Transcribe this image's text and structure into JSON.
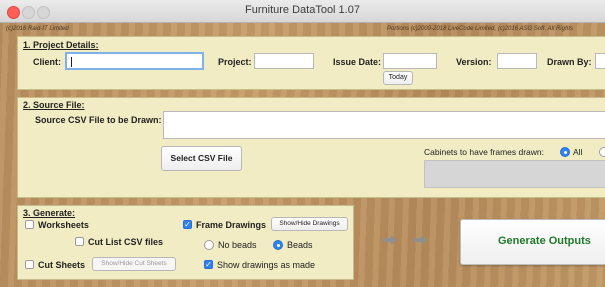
{
  "window": {
    "title": "Furniture DataTool 1.07"
  },
  "header": {
    "left_credit": "(c)2016 Raid-IT Limited",
    "right_credit": "Portions (c)2000-2018 LiveCode Limited, (c)2016 ASG Soft. All Rights"
  },
  "project": {
    "heading": "1. Project Details:",
    "client_label": "Client:",
    "client_value": "",
    "project_label": "Project:",
    "project_value": "",
    "issue_date_label": "Issue Date:",
    "issue_date_value": "",
    "today_button": "Today",
    "version_label": "Version:",
    "version_value": "",
    "drawn_by_label": "Drawn By:",
    "drawn_by_value": ""
  },
  "source": {
    "heading": "2. Source File:",
    "csv_label": "Source CSV File to be Drawn:",
    "csv_value": "",
    "select_button": "Select CSV File",
    "cabinets_label": "Cabinets to have frames drawn:",
    "cabinets_option_all": "All"
  },
  "generate": {
    "heading": "3. Generate:",
    "worksheets_label": "Worksheets",
    "cut_list_label": "Cut List CSV files",
    "cut_sheets_label": "Cut Sheets",
    "show_hide_cut_sheets": "Show/Hide Cut Sheets",
    "frame_drawings_label": "Frame Drawings",
    "show_hide_drawings": "Show/Hide Drawings",
    "no_beads_label": "No beads",
    "beads_label": "Beads",
    "show_drawings_label": "Show drawings as made",
    "generate_button": "Generate Outputs",
    "accent_color": "#2f82f3",
    "generate_color": "#1f7a2a"
  }
}
